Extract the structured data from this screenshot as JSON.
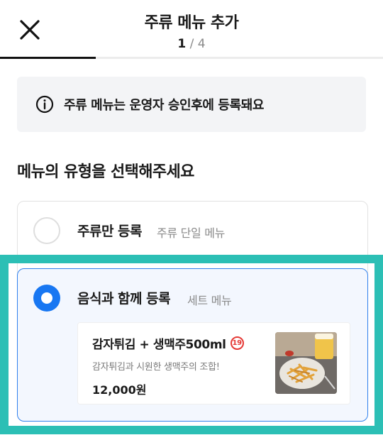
{
  "header": {
    "title": "주류 메뉴 추가",
    "step_current": "1",
    "step_separator": " / ",
    "step_total": "4",
    "progress_fraction": 0.25
  },
  "notice": {
    "icon": "info-icon",
    "text": "주류 메뉴는 운영자 승인후에 등록돼요"
  },
  "section_title": "메뉴의 유형을 선택해주세요",
  "options": [
    {
      "label": "주류만 등록",
      "sub": "주류 단일 메뉴",
      "selected": false
    },
    {
      "label": "음식과 함께 등록",
      "sub": "세트 메뉴",
      "selected": true,
      "menu": {
        "name": "감자튀김 + 생맥주500ml",
        "age_badge": "19",
        "description": "감자튀김과 시원한 생맥주의 조합!",
        "price": "12,000원"
      }
    }
  ],
  "colors": {
    "accent": "#1877f2",
    "selected_border": "#2f80ed",
    "highlight": "#2cbfb5",
    "age_badge": "#e53935"
  }
}
